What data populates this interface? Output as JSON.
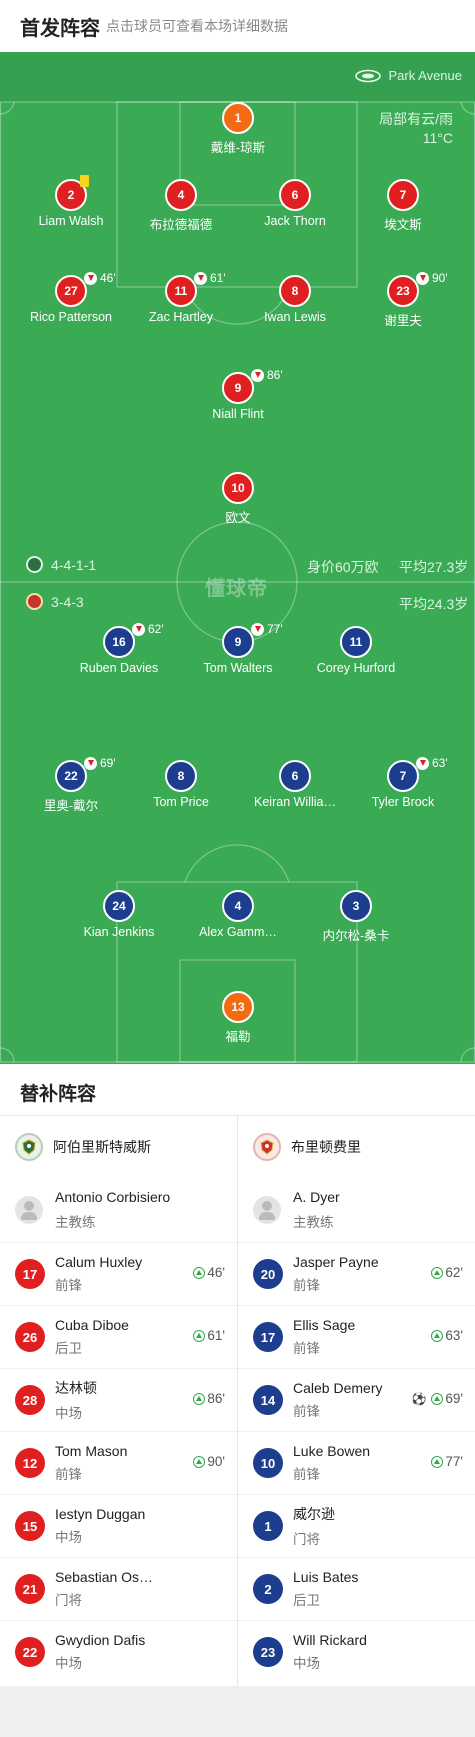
{
  "header": {
    "title": "首发阵容",
    "subtitle": "点击球员可查看本场详细数据"
  },
  "pitch": {
    "venue": "Park Avenue",
    "weather": "局部有云/雨",
    "temperature": "11°C",
    "watermark": "懂球帝",
    "home_formation": "4-4-1-1",
    "home_value": "身价60万欧",
    "home_avg_age": "平均27.3岁",
    "away_formation": "3-4-3",
    "away_avg_age": "平均24.3岁",
    "colors": {
      "home": "#e02020",
      "away": "#1d3d8f",
      "keeper": "#f26b12",
      "pitch": "#3aaa55"
    }
  },
  "home_players": [
    {
      "number": "1",
      "name": "戴维-琼斯",
      "keeper": true
    },
    {
      "number": "2",
      "name": "Liam Walsh",
      "yellow_card": true
    },
    {
      "number": "4",
      "name": "布拉德福德"
    },
    {
      "number": "6",
      "name": "Jack Thorn"
    },
    {
      "number": "7",
      "name": "埃文斯"
    },
    {
      "number": "27",
      "name": "Rico Patterson",
      "sub_off": "46'"
    },
    {
      "number": "11",
      "name": "Zac Hartley",
      "sub_off": "61'"
    },
    {
      "number": "8",
      "name": "Iwan Lewis"
    },
    {
      "number": "23",
      "name": "谢里夫",
      "sub_off": "90'"
    },
    {
      "number": "9",
      "name": "Niall Flint",
      "sub_off": "86'"
    },
    {
      "number": "10",
      "name": "欧文"
    }
  ],
  "away_players": [
    {
      "number": "16",
      "name": "Ruben Davies",
      "sub_off": "62'"
    },
    {
      "number": "9",
      "name": "Tom Walters",
      "sub_off": "77'"
    },
    {
      "number": "11",
      "name": "Corey Hurford"
    },
    {
      "number": "22",
      "name": "里奥-戴尔",
      "sub_off": "69'"
    },
    {
      "number": "8",
      "name": "Tom Price"
    },
    {
      "number": "6",
      "name": "Keiran Willia…"
    },
    {
      "number": "7",
      "name": "Tyler Brock",
      "sub_off": "63'"
    },
    {
      "number": "24",
      "name": "Kian Jenkins"
    },
    {
      "number": "4",
      "name": "Alex Gamm…"
    },
    {
      "number": "3",
      "name": "内尔松-桑卡"
    },
    {
      "number": "13",
      "name": "福勒",
      "keeper": true
    }
  ],
  "substitutes": {
    "title": "替补阵容",
    "home": {
      "team_name": "阿伯里斯特威斯",
      "coach_name": "Antonio Corbisiero",
      "coach_role": "主教练",
      "players": [
        {
          "number": "17",
          "name": "Calum Huxley",
          "position": "前锋",
          "sub_on": "46'"
        },
        {
          "number": "26",
          "name": "Cuba Diboe",
          "position": "后卫",
          "sub_on": "61'"
        },
        {
          "number": "28",
          "name": "达林顿",
          "position": "中场",
          "sub_on": "86'"
        },
        {
          "number": "12",
          "name": "Tom Mason",
          "position": "前锋",
          "sub_on": "90'"
        },
        {
          "number": "15",
          "name": "Iestyn Duggan",
          "position": "中场"
        },
        {
          "number": "21",
          "name": "Sebastian Os…",
          "position": "门将"
        },
        {
          "number": "22",
          "name": "Gwydion Dafis",
          "position": "中场"
        }
      ]
    },
    "away": {
      "team_name": "布里顿费里",
      "coach_name": "A. Dyer",
      "coach_role": "主教练",
      "players": [
        {
          "number": "20",
          "name": "Jasper Payne",
          "position": "前锋",
          "sub_on": "62'"
        },
        {
          "number": "17",
          "name": "Ellis Sage",
          "position": "前锋",
          "sub_on": "63'"
        },
        {
          "number": "14",
          "name": "Caleb Demery",
          "position": "前锋",
          "sub_on": "69'",
          "goal": true
        },
        {
          "number": "10",
          "name": "Luke Bowen",
          "position": "前锋",
          "sub_on": "77'"
        },
        {
          "number": "1",
          "name": "威尔逊",
          "position": "门将"
        },
        {
          "number": "2",
          "name": "Luis Bates",
          "position": "后卫"
        },
        {
          "number": "23",
          "name": "Will Rickard",
          "position": "中场"
        }
      ]
    }
  }
}
